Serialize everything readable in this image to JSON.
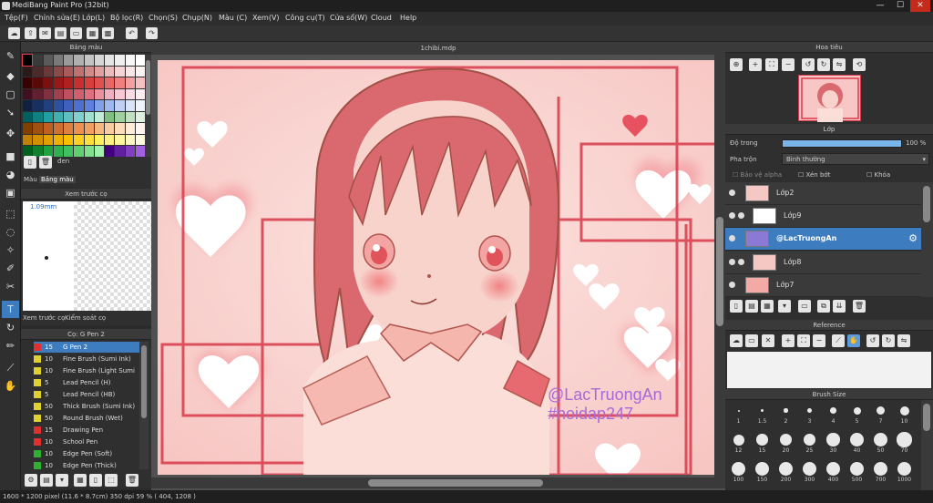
{
  "window": {
    "title": "MediBang Paint Pro (32bit)",
    "minimize": "—",
    "maximize": "☐",
    "close": "✕"
  },
  "menu": [
    "Tệp(F)",
    "Chỉnh sửa(E)",
    "Lớp(L)",
    "Bộ lọc(R)",
    "Chọn(S)",
    "Chụp(N)",
    "Màu (C)",
    "Xem(V)",
    "Công cụ(T)",
    "Cửa sổ(W)",
    "Cloud",
    "Help"
  ],
  "color_panel": {
    "title": "Bảng màu",
    "color_name": "đen",
    "tabs": [
      "Màu",
      "Bảng màu"
    ],
    "swatches": [
      "#000000",
      "#3a3a3a",
      "#5a5a5a",
      "#7a7a7a",
      "#9a9a9a",
      "#b0b0b0",
      "#c4c4c4",
      "#d6d6d6",
      "#e4e4e4",
      "#efefef",
      "#f7f7f7",
      "#ffffff",
      "#2a1a1a",
      "#4a2a2a",
      "#6a3a3a",
      "#8a4a4a",
      "#aa5a5a",
      "#c07070",
      "#d08a8a",
      "#e0a0a0",
      "#ecbcbc",
      "#f4d4d4",
      "#f9e6e6",
      "#fdf3f3",
      "#3a0000",
      "#5a0808",
      "#7a1010",
      "#9a1818",
      "#b02020",
      "#c83030",
      "#d84040",
      "#e05050",
      "#e86868",
      "#f08080",
      "#f4a0a0",
      "#f8c0c0",
      "#401020",
      "#602030",
      "#803040",
      "#a04050",
      "#c05060",
      "#d06070",
      "#e07080",
      "#ec90a0",
      "#f0b0c0",
      "#f6c8d4",
      "#fadce4",
      "#fdeef2",
      "#102040",
      "#183060",
      "#204080",
      "#3050a0",
      "#4060c0",
      "#5070d0",
      "#6080e0",
      "#80a0e8",
      "#a0b8f0",
      "#c0d0f4",
      "#d8e4f8",
      "#eef3fc",
      "#006060",
      "#108080",
      "#20a0a0",
      "#40b0b0",
      "#60c0c0",
      "#80d0d0",
      "#a0e0d0",
      "#c0ecd8",
      "#80c080",
      "#a0d0a0",
      "#c0e0c0",
      "#e0f0e0",
      "#804000",
      "#a05010",
      "#c06020",
      "#d07030",
      "#e08040",
      "#f09050",
      "#f0a060",
      "#f4b880",
      "#f8cca0",
      "#fbddbc",
      "#fdecd8",
      "#fef6ee",
      "#c08000",
      "#d09000",
      "#e0a000",
      "#f0b000",
      "#f8c000",
      "#ffd020",
      "#ffe040",
      "#fff060",
      "#fff080",
      "#fff4a0",
      "#fff8c0",
      "#fffce0",
      "#006020",
      "#108030",
      "#20a040",
      "#30b050",
      "#40c060",
      "#60d070",
      "#80e090",
      "#a0f0b0",
      "#400080",
      "#6020a0",
      "#8040c0",
      "#a060e0"
    ]
  },
  "brush_preview": {
    "title": "Xem trước cọ",
    "size": "1.09mm",
    "tabs": [
      "Xem trước cọ",
      "Kiểm soát cọ"
    ]
  },
  "brush_list": {
    "title": "Cọ: G Pen 2",
    "items": [
      {
        "size": "15",
        "name": "G Pen 2",
        "color": "#e03030",
        "selected": true
      },
      {
        "size": "10",
        "name": "Fine Brush (Sumi Ink)",
        "color": "#e0d030"
      },
      {
        "size": "10",
        "name": "Fine Brush (Light Sumi",
        "color": "#e0d030"
      },
      {
        "size": "5",
        "name": "Lead Pencil (H)",
        "color": "#e0d030"
      },
      {
        "size": "5",
        "name": "Lead Pencil (HB)",
        "color": "#e0d030"
      },
      {
        "size": "50",
        "name": "Thick Brush (Sumi Ink)",
        "color": "#e0d030"
      },
      {
        "size": "50",
        "name": "Round Brush (Wet)",
        "color": "#e0d030"
      },
      {
        "size": "15",
        "name": "Drawing Pen",
        "color": "#e03030"
      },
      {
        "size": "10",
        "name": "School Pen",
        "color": "#e03030"
      },
      {
        "size": "10",
        "name": "Edge Pen (Soft)",
        "color": "#30b030"
      },
      {
        "size": "10",
        "name": "Edge Pen (Thick)",
        "color": "#30b030"
      }
    ]
  },
  "document": {
    "tab": "1chibi.mdp"
  },
  "artwork": {
    "watermark_line1": "@LacTruongAn",
    "watermark_line2": "#hoidap247"
  },
  "navigator": {
    "title": "Hoa tiêu"
  },
  "layers": {
    "title": "Lớp",
    "opacity_label": "Độ trong",
    "opacity_value": "100 %",
    "blend_label": "Pha trộn",
    "blend_value": "Bình thường",
    "protect_alpha": "Bảo vệ alpha",
    "clipping": "Xén bớt",
    "lock": "Khóa",
    "items": [
      {
        "name": "Lớp2",
        "indent": false,
        "selected": false
      },
      {
        "name": "Lớp9",
        "indent": true,
        "selected": false
      },
      {
        "name": "@LacTruongAn",
        "indent": false,
        "selected": true
      },
      {
        "name": "Lớp8",
        "indent": true,
        "selected": false
      },
      {
        "name": "Lớp7",
        "indent": false,
        "selected": false
      }
    ]
  },
  "reference": {
    "title": "Reference"
  },
  "brush_size": {
    "title": "Brush Size",
    "sizes": [
      "1",
      "1.5",
      "2",
      "3",
      "4",
      "5",
      "7",
      "10",
      "12",
      "15",
      "20",
      "25",
      "30",
      "40",
      "50",
      "70",
      "100",
      "150",
      "200",
      "300",
      "400",
      "500",
      "700",
      "1000"
    ]
  },
  "status": {
    "dimensions": "1600 * 1200 pixel",
    "physical": "(11.6 * 8.7cm)",
    "dpi": "350 dpi",
    "zoom": "59 %",
    "cursor": "( 404, 1208 )"
  },
  "colors": {
    "accent": "#3c7cbf",
    "heart_red": "#e53b4b",
    "frame_red": "#d8394a"
  }
}
